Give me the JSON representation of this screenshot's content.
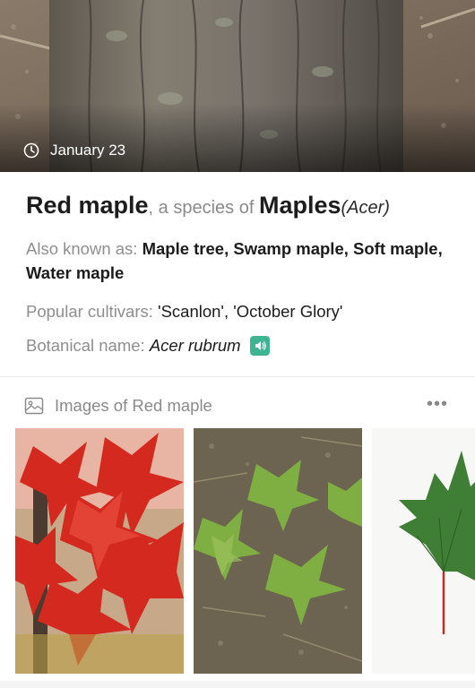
{
  "hero": {
    "date": "January 23",
    "icon": "clock-icon"
  },
  "plant": {
    "common_name": "Red maple",
    "species_of_text": ", a species of ",
    "genus_name": "Maples",
    "genus_scientific": "(Acer)",
    "also_known_as_label": "Also known as: ",
    "also_known_as_value": "Maple tree, Swamp maple, Soft maple, Water maple",
    "cultivars_label": "Popular cultivars: ",
    "cultivars_value": "'Scanlon', 'October Glory'",
    "botanical_label": "Botanical name: ",
    "botanical_value": "Acer rubrum",
    "speaker_icon": "speaker-icon"
  },
  "images_section": {
    "title": "Images of Red maple",
    "more_label": "•••",
    "icon": "gallery-icon",
    "images": [
      {
        "name": "red-leaves-image"
      },
      {
        "name": "green-leaves-ground-image"
      },
      {
        "name": "single-leaf-image"
      }
    ]
  },
  "colors": {
    "accent": "#3db592",
    "muted_text": "#8e8e8e",
    "primary_text": "#1c1c1c"
  }
}
